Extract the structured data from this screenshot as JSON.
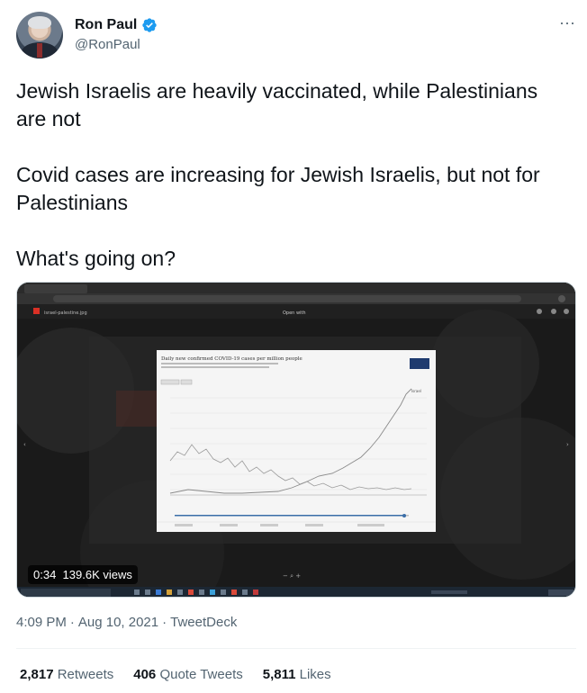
{
  "author": {
    "display_name": "Ron Paul",
    "handle": "@RonPaul",
    "verified": true
  },
  "tweet": {
    "paragraphs": [
      "Jewish Israelis are heavily vaccinated, while Palestinians are not",
      "Covid cases are increasing for Jewish Israelis, but not for Palestinians",
      "What's going on?"
    ]
  },
  "video": {
    "time": "0:34",
    "views": "139.6K views",
    "browser_tab": "israel-palestine.jpg",
    "open_with": "Open with",
    "chart_title": "Daily new confirmed COVID-19 cases per million people",
    "chart_dates": [
      "Mar 24, 2021",
      "Apr 4, 2021",
      "Apr 24, 2021",
      "May 14, 2021",
      "Jun 24, 2021",
      "Jul 4, 2021",
      "Jul 24, 2021",
      "Jul 27, 2021"
    ],
    "chart_y_ticks": [
      "500",
      "450",
      "400",
      "350",
      "300",
      "250",
      "200",
      "150",
      "100",
      "50",
      "20",
      "0"
    ]
  },
  "meta": {
    "time": "4:09 PM",
    "sep": "·",
    "date": "Aug 10, 2021",
    "client": "TweetDeck"
  },
  "stats": {
    "retweets_count": "2,817",
    "retweets_label": "Retweets",
    "quotes_count": "406",
    "quotes_label": "Quote Tweets",
    "likes_count": "5,811",
    "likes_label": "Likes"
  },
  "colors": {
    "verified": "#1d9bf0",
    "secondary_text": "#536471"
  }
}
